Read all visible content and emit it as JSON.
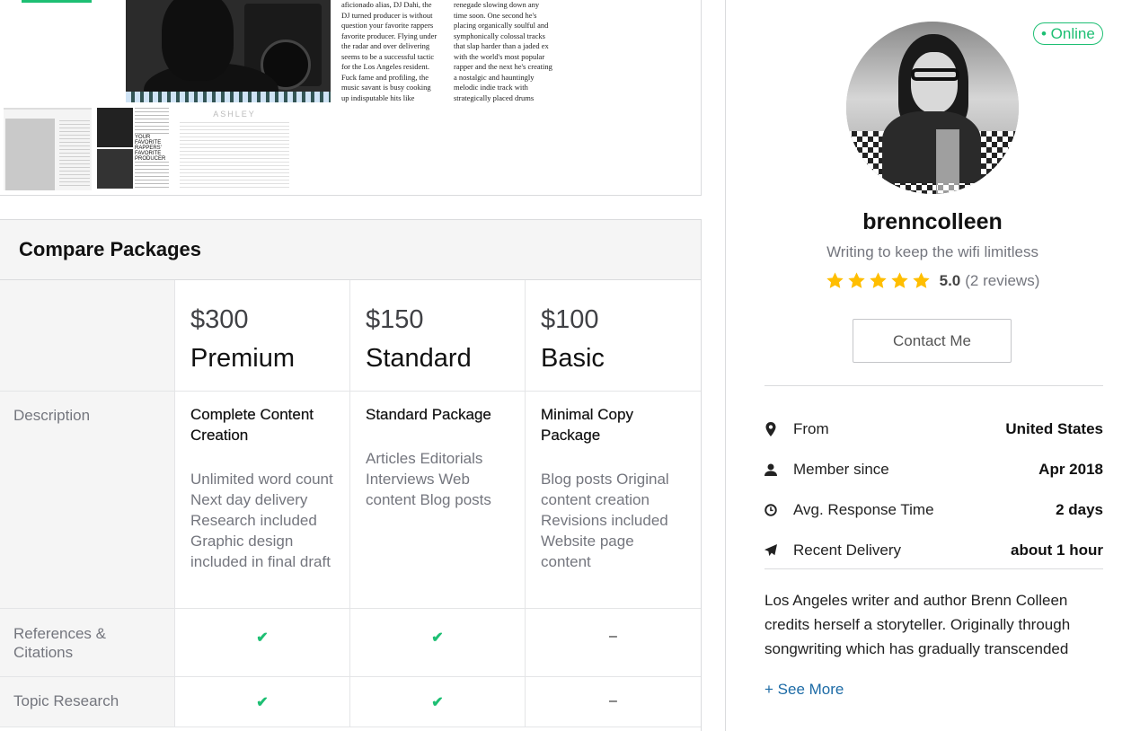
{
  "gallery": {
    "article_col1": "aficionado alias, DJ Dahi, the DJ turned producer is without question your favorite rappers favorite producer. Flying under the radar and over delivering seems to be a successful tactic for the Los Angeles resident. Fuck fame and profiling, the music savant is busy cooking up indisputable hits like",
    "article_col2": "renegade slowing down any time soon. One second he's placing organically soulful and symphonically colossal tracks that slap harder than a jaded ex with the world's most popular rapper and the next he's creating a nostalgic and hauntingly melodic indie track with strategically placed drums",
    "thumb2_heading": "YOUR FAVORITE RAPPERS' FAVORITE PRODUCER",
    "thumb3_heading": "ASHLEY"
  },
  "packages": {
    "title": "Compare Packages",
    "tiers": [
      {
        "price": "$300",
        "name": "Premium",
        "desc_title": "Complete Content Creation",
        "desc_body": "Unlimited word count Next day delivery Research included Graphic design included in final draft"
      },
      {
        "price": "$150",
        "name": "Standard",
        "desc_title": "Standard Package",
        "desc_body": "Articles Editorials Interviews Web content Blog posts"
      },
      {
        "price": "$100",
        "name": "Basic",
        "desc_title": "Minimal Copy Package",
        "desc_body": "Blog posts Original content creation Revisions included Website page content"
      }
    ],
    "row_labels": {
      "description": "Description",
      "references": "References & Citations",
      "topic_research": "Topic Research"
    },
    "features": {
      "references": [
        "✔",
        "✔",
        "–"
      ],
      "topic_research": [
        "✔",
        "✔",
        "–"
      ]
    }
  },
  "seller": {
    "status": "• Online",
    "username": "brenncolleen",
    "tagline": "Writing to keep the wifi limitless",
    "rating": "5.0",
    "reviews": "(2 reviews)",
    "contact_label": "Contact Me",
    "stats": [
      {
        "label": "From",
        "value": "United States",
        "icon": "map-pin-icon"
      },
      {
        "label": "Member since",
        "value": "Apr 2018",
        "icon": "user-icon"
      },
      {
        "label": "Avg. Response Time",
        "value": "2 days",
        "icon": "clock-icon"
      },
      {
        "label": "Recent Delivery",
        "value": "about 1 hour",
        "icon": "paper-plane-icon"
      }
    ],
    "bio": "Los Angeles writer and author Brenn Colleen credits herself a storyteller. Originally through songwriting which has gradually transcended",
    "see_more": "+ See More"
  },
  "colors": {
    "accent_green": "#1dbf73",
    "star": "#ffbe00",
    "link": "#1d6ba6"
  }
}
